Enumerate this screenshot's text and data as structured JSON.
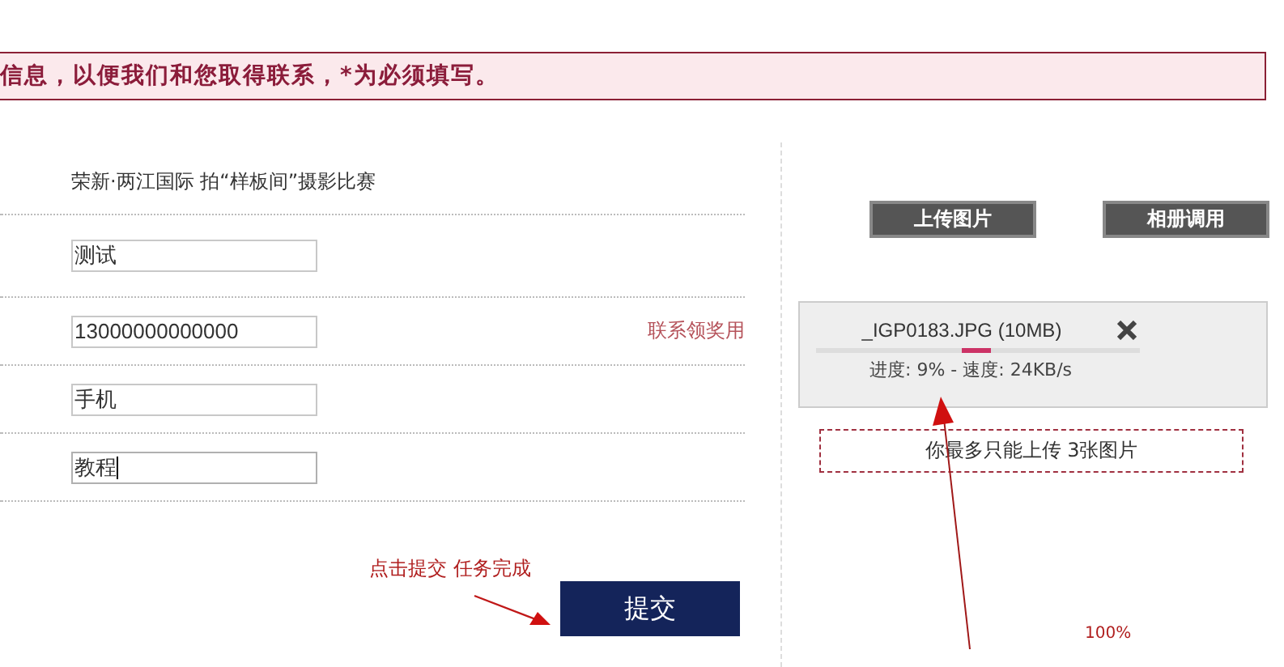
{
  "banner": {
    "text": "信息，以便我们和您取得联系，*为必须填写。"
  },
  "form": {
    "contest": "荣新·两江国际 拍“样板间”摄影比赛",
    "fields": [
      {
        "value": "测试",
        "focused": false
      },
      {
        "value": "13000000000000",
        "focused": false,
        "hint": "联系领奖用"
      },
      {
        "value": "手机",
        "focused": false
      },
      {
        "value": "教程",
        "focused": true
      }
    ],
    "annotation": "点击提交 任务完成",
    "submit": "提交"
  },
  "upload": {
    "buttons": [
      "上传图片",
      "相册调用"
    ],
    "file": {
      "name": "_IGP0183.JPG (10MB)",
      "status": "进度: 9% - 速度: 24KB/s"
    },
    "limit": "你最多只能上传 3张图片",
    "progress_label": "100%"
  }
}
